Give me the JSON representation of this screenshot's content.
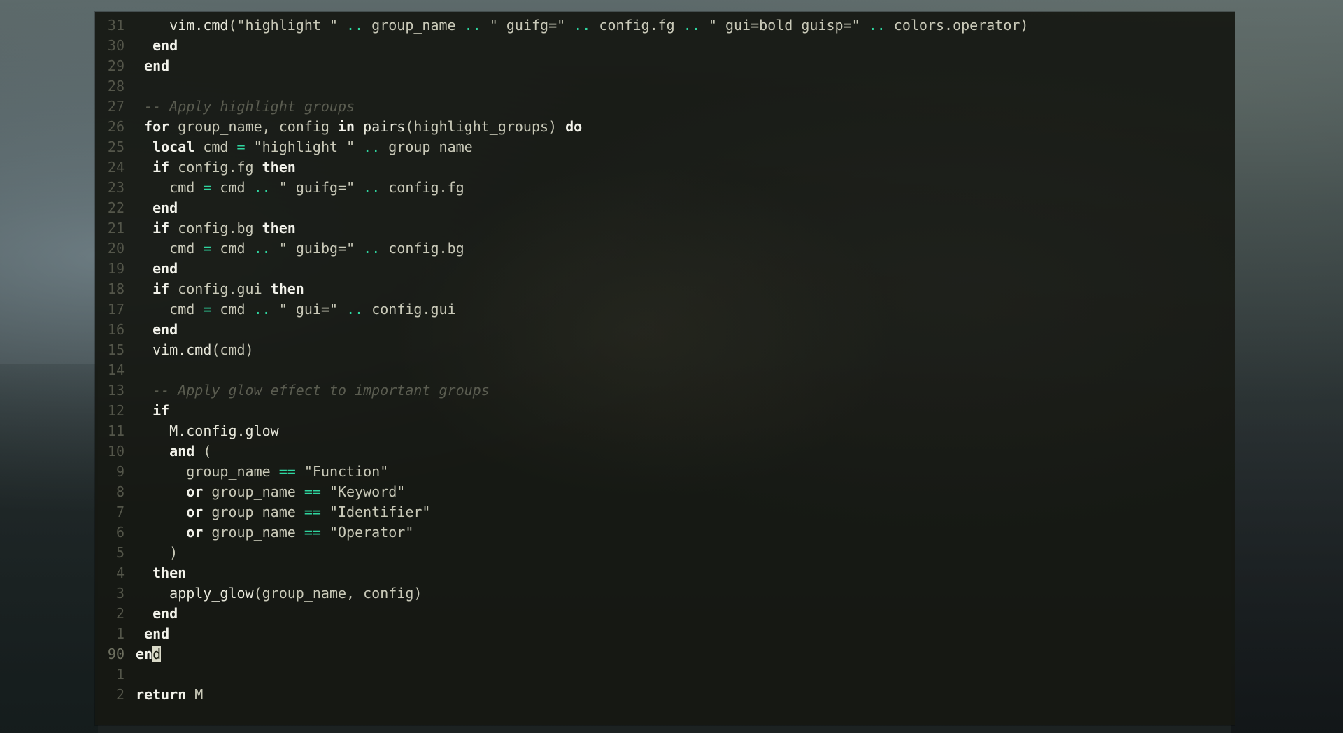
{
  "editor": {
    "lines": [
      {
        "num": "31",
        "indent": "    ",
        "tokens": [
          [
            "fn",
            "vim.cmd"
          ],
          [
            "p",
            "(\"highlight \" "
          ],
          [
            "op",
            ".."
          ],
          [
            "p",
            " group_name "
          ],
          [
            "op",
            ".."
          ],
          [
            "p",
            " \" guifg=\" "
          ],
          [
            "op",
            ".."
          ],
          [
            "p",
            " config.fg "
          ],
          [
            "op",
            ".."
          ],
          [
            "p",
            " \" gui=bold guisp=\" "
          ],
          [
            "op",
            ".."
          ],
          [
            "p",
            " colors.operator)"
          ]
        ]
      },
      {
        "num": "30",
        "indent": "  ",
        "tokens": [
          [
            "kw",
            "end"
          ]
        ]
      },
      {
        "num": "29",
        "indent": " ",
        "tokens": [
          [
            "kw",
            "end"
          ]
        ]
      },
      {
        "num": "28",
        "indent": "",
        "tokens": []
      },
      {
        "num": "27",
        "indent": " ",
        "tokens": [
          [
            "cm",
            "-- Apply highlight groups"
          ]
        ]
      },
      {
        "num": "26",
        "indent": " ",
        "tokens": [
          [
            "kw",
            "for"
          ],
          [
            "p",
            " group_name, config "
          ],
          [
            "kw",
            "in"
          ],
          [
            "p",
            " "
          ],
          [
            "fn",
            "pairs"
          ],
          [
            "p",
            "(highlight_groups) "
          ],
          [
            "kw",
            "do"
          ]
        ]
      },
      {
        "num": "25",
        "indent": "  ",
        "tokens": [
          [
            "kw",
            "local"
          ],
          [
            "p",
            " cmd "
          ],
          [
            "op",
            "="
          ],
          [
            "p",
            " \"highlight \" "
          ],
          [
            "op",
            ".."
          ],
          [
            "p",
            " group_name"
          ]
        ]
      },
      {
        "num": "24",
        "indent": "  ",
        "tokens": [
          [
            "kw",
            "if"
          ],
          [
            "p",
            " config.fg "
          ],
          [
            "kw",
            "then"
          ]
        ]
      },
      {
        "num": "23",
        "indent": "    ",
        "tokens": [
          [
            "p",
            "cmd "
          ],
          [
            "op",
            "="
          ],
          [
            "p",
            " cmd "
          ],
          [
            "op",
            ".."
          ],
          [
            "p",
            " \" guifg=\" "
          ],
          [
            "op",
            ".."
          ],
          [
            "p",
            " config.fg"
          ]
        ]
      },
      {
        "num": "22",
        "indent": "  ",
        "tokens": [
          [
            "kw",
            "end"
          ]
        ]
      },
      {
        "num": "21",
        "indent": "  ",
        "tokens": [
          [
            "kw",
            "if"
          ],
          [
            "p",
            " config.bg "
          ],
          [
            "kw",
            "then"
          ]
        ]
      },
      {
        "num": "20",
        "indent": "    ",
        "tokens": [
          [
            "p",
            "cmd "
          ],
          [
            "op",
            "="
          ],
          [
            "p",
            " cmd "
          ],
          [
            "op",
            ".."
          ],
          [
            "p",
            " \" guibg=\" "
          ],
          [
            "op",
            ".."
          ],
          [
            "p",
            " config.bg"
          ]
        ]
      },
      {
        "num": "19",
        "indent": "  ",
        "tokens": [
          [
            "kw",
            "end"
          ]
        ]
      },
      {
        "num": "18",
        "indent": "  ",
        "tokens": [
          [
            "kw",
            "if"
          ],
          [
            "p",
            " config.gui "
          ],
          [
            "kw",
            "then"
          ]
        ]
      },
      {
        "num": "17",
        "indent": "    ",
        "tokens": [
          [
            "p",
            "cmd "
          ],
          [
            "op",
            "="
          ],
          [
            "p",
            " cmd "
          ],
          [
            "op",
            ".."
          ],
          [
            "p",
            " \" gui=\" "
          ],
          [
            "op",
            ".."
          ],
          [
            "p",
            " config.gui"
          ]
        ]
      },
      {
        "num": "16",
        "indent": "  ",
        "tokens": [
          [
            "kw",
            "end"
          ]
        ]
      },
      {
        "num": "15",
        "indent": "  ",
        "tokens": [
          [
            "fn",
            "vim.cmd"
          ],
          [
            "p",
            "(cmd)"
          ]
        ]
      },
      {
        "num": "14",
        "indent": "",
        "tokens": []
      },
      {
        "num": "13",
        "indent": "  ",
        "tokens": [
          [
            "cm",
            "-- Apply glow effect to important groups"
          ]
        ]
      },
      {
        "num": "12",
        "indent": "  ",
        "tokens": [
          [
            "kw",
            "if"
          ]
        ]
      },
      {
        "num": "11",
        "indent": "    ",
        "tokens": [
          [
            "fn",
            "M.config.glow"
          ]
        ]
      },
      {
        "num": "10",
        "indent": "    ",
        "tokens": [
          [
            "kw",
            "and"
          ],
          [
            "p",
            " ("
          ]
        ]
      },
      {
        "num": "9",
        "indent": "      ",
        "tokens": [
          [
            "p",
            "group_name "
          ],
          [
            "op",
            "=="
          ],
          [
            "p",
            " \"Function\""
          ]
        ]
      },
      {
        "num": "8",
        "indent": "      ",
        "tokens": [
          [
            "kw",
            "or"
          ],
          [
            "p",
            " group_name "
          ],
          [
            "op",
            "=="
          ],
          [
            "p",
            " \"Keyword\""
          ]
        ]
      },
      {
        "num": "7",
        "indent": "      ",
        "tokens": [
          [
            "kw",
            "or"
          ],
          [
            "p",
            " group_name "
          ],
          [
            "op",
            "=="
          ],
          [
            "p",
            " \"Identifier\""
          ]
        ]
      },
      {
        "num": "6",
        "indent": "      ",
        "tokens": [
          [
            "kw",
            "or"
          ],
          [
            "p",
            " group_name "
          ],
          [
            "op",
            "=="
          ],
          [
            "p",
            " \"Operator\""
          ]
        ]
      },
      {
        "num": "5",
        "indent": "    ",
        "tokens": [
          [
            "p",
            ")"
          ]
        ]
      },
      {
        "num": "4",
        "indent": "  ",
        "tokens": [
          [
            "kw",
            "then"
          ]
        ]
      },
      {
        "num": "3",
        "indent": "    ",
        "tokens": [
          [
            "fn",
            "apply_glow"
          ],
          [
            "p",
            "(group_name, config)"
          ]
        ]
      },
      {
        "num": "2",
        "indent": "  ",
        "tokens": [
          [
            "kw",
            "end"
          ]
        ]
      },
      {
        "num": "1",
        "indent": " ",
        "tokens": [
          [
            "kw",
            "end"
          ]
        ]
      },
      {
        "num": "90",
        "indent": "",
        "tokens": [
          [
            "kw",
            "en"
          ],
          [
            "cursor",
            "d"
          ]
        ],
        "current": true
      },
      {
        "num": "1",
        "indent": "",
        "tokens": []
      },
      {
        "num": "2",
        "indent": "",
        "tokens": [
          [
            "kw",
            "return"
          ],
          [
            "p",
            " M"
          ]
        ]
      }
    ]
  },
  "colors": {
    "keyword": "#f2f2ea",
    "operator": "#2fd6a0",
    "comment": "#5a5c50",
    "line_number": "#54564a",
    "editor_background": "#16180f"
  }
}
